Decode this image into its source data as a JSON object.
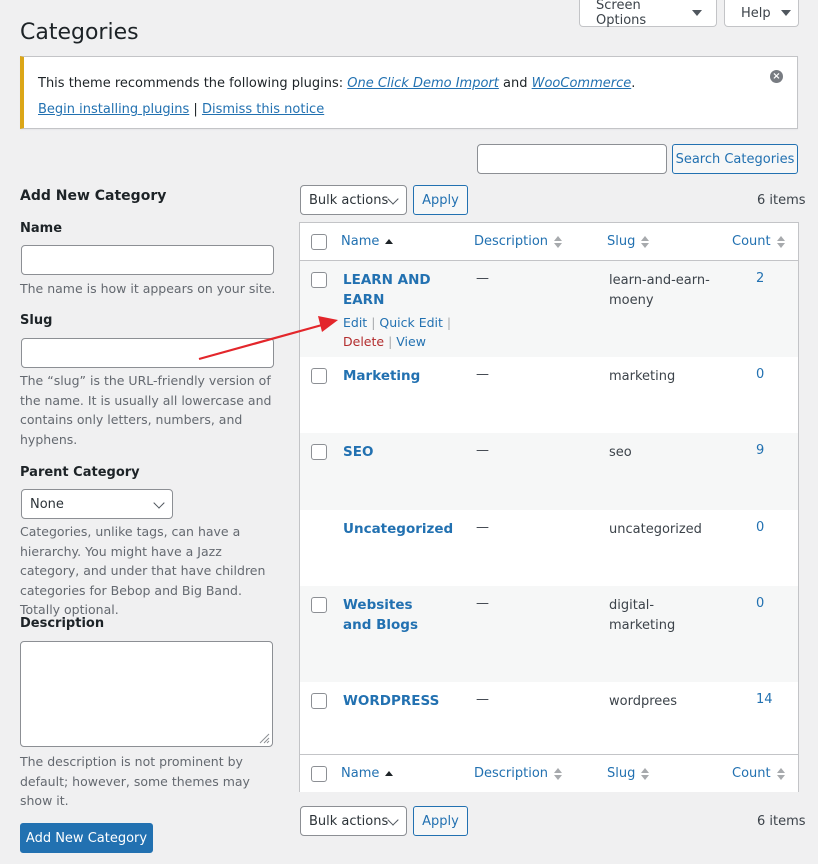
{
  "header": {
    "title": "Categories",
    "screen_options": "Screen Options",
    "help": "Help"
  },
  "notice": {
    "text_before": "This theme recommends the following plugins:",
    "plugin1": "One Click Demo Import",
    "and": "and",
    "plugin2": "WooCommerce",
    "period": ".",
    "begin": "Begin installing plugins",
    "sep": "|",
    "dismiss": "Dismiss this notice"
  },
  "search": {
    "value": "",
    "button": "Search Categories"
  },
  "form": {
    "heading": "Add New Category",
    "name_label": "Name",
    "name_value": "",
    "name_help": "The name is how it appears on your site.",
    "slug_label": "Slug",
    "slug_value": "",
    "slug_help": "The “slug” is the URL-friendly version of the name. It is usually all lowercase and contains only letters, numbers, and hyphens.",
    "parent_label": "Parent Category",
    "parent_value": "None",
    "parent_help": "Categories, unlike tags, can have a hierarchy. You might have a Jazz category, and under that have children categories for Bebop and Big Band. Totally optional.",
    "desc_label": "Description",
    "desc_value": "",
    "desc_help": "The description is not prominent by default; however, some themes may show it.",
    "submit": "Add New Category"
  },
  "tablenav": {
    "bulk": "Bulk actions",
    "apply": "Apply",
    "items": "6 items"
  },
  "columns": {
    "name": "Name",
    "description": "Description",
    "slug": "Slug",
    "count": "Count"
  },
  "rows": [
    {
      "name": "LEARN AND EARN",
      "description": "—",
      "slug": "learn-and-earn-moeny",
      "count": "2"
    },
    {
      "name": "Marketing",
      "description": "—",
      "slug": "marketing",
      "count": "0"
    },
    {
      "name": "SEO",
      "description": "—",
      "slug": "seo",
      "count": "9"
    },
    {
      "name": "Uncategorized",
      "description": "—",
      "slug": "uncategorized",
      "count": "0"
    },
    {
      "name": "Websites and Blogs",
      "description": "—",
      "slug": "digital-marketing",
      "count": "0"
    },
    {
      "name": "WORDPRESS",
      "description": "—",
      "slug": "wordprees",
      "count": "14"
    }
  ],
  "row_actions": {
    "edit": "Edit",
    "quick_edit": "Quick Edit",
    "delete": "Delete",
    "view": "View",
    "sep": "|"
  },
  "colors": {
    "link": "#2271b1",
    "notice_border": "#dba617",
    "delete": "#b32d2e",
    "arrow": "#e3262b"
  }
}
